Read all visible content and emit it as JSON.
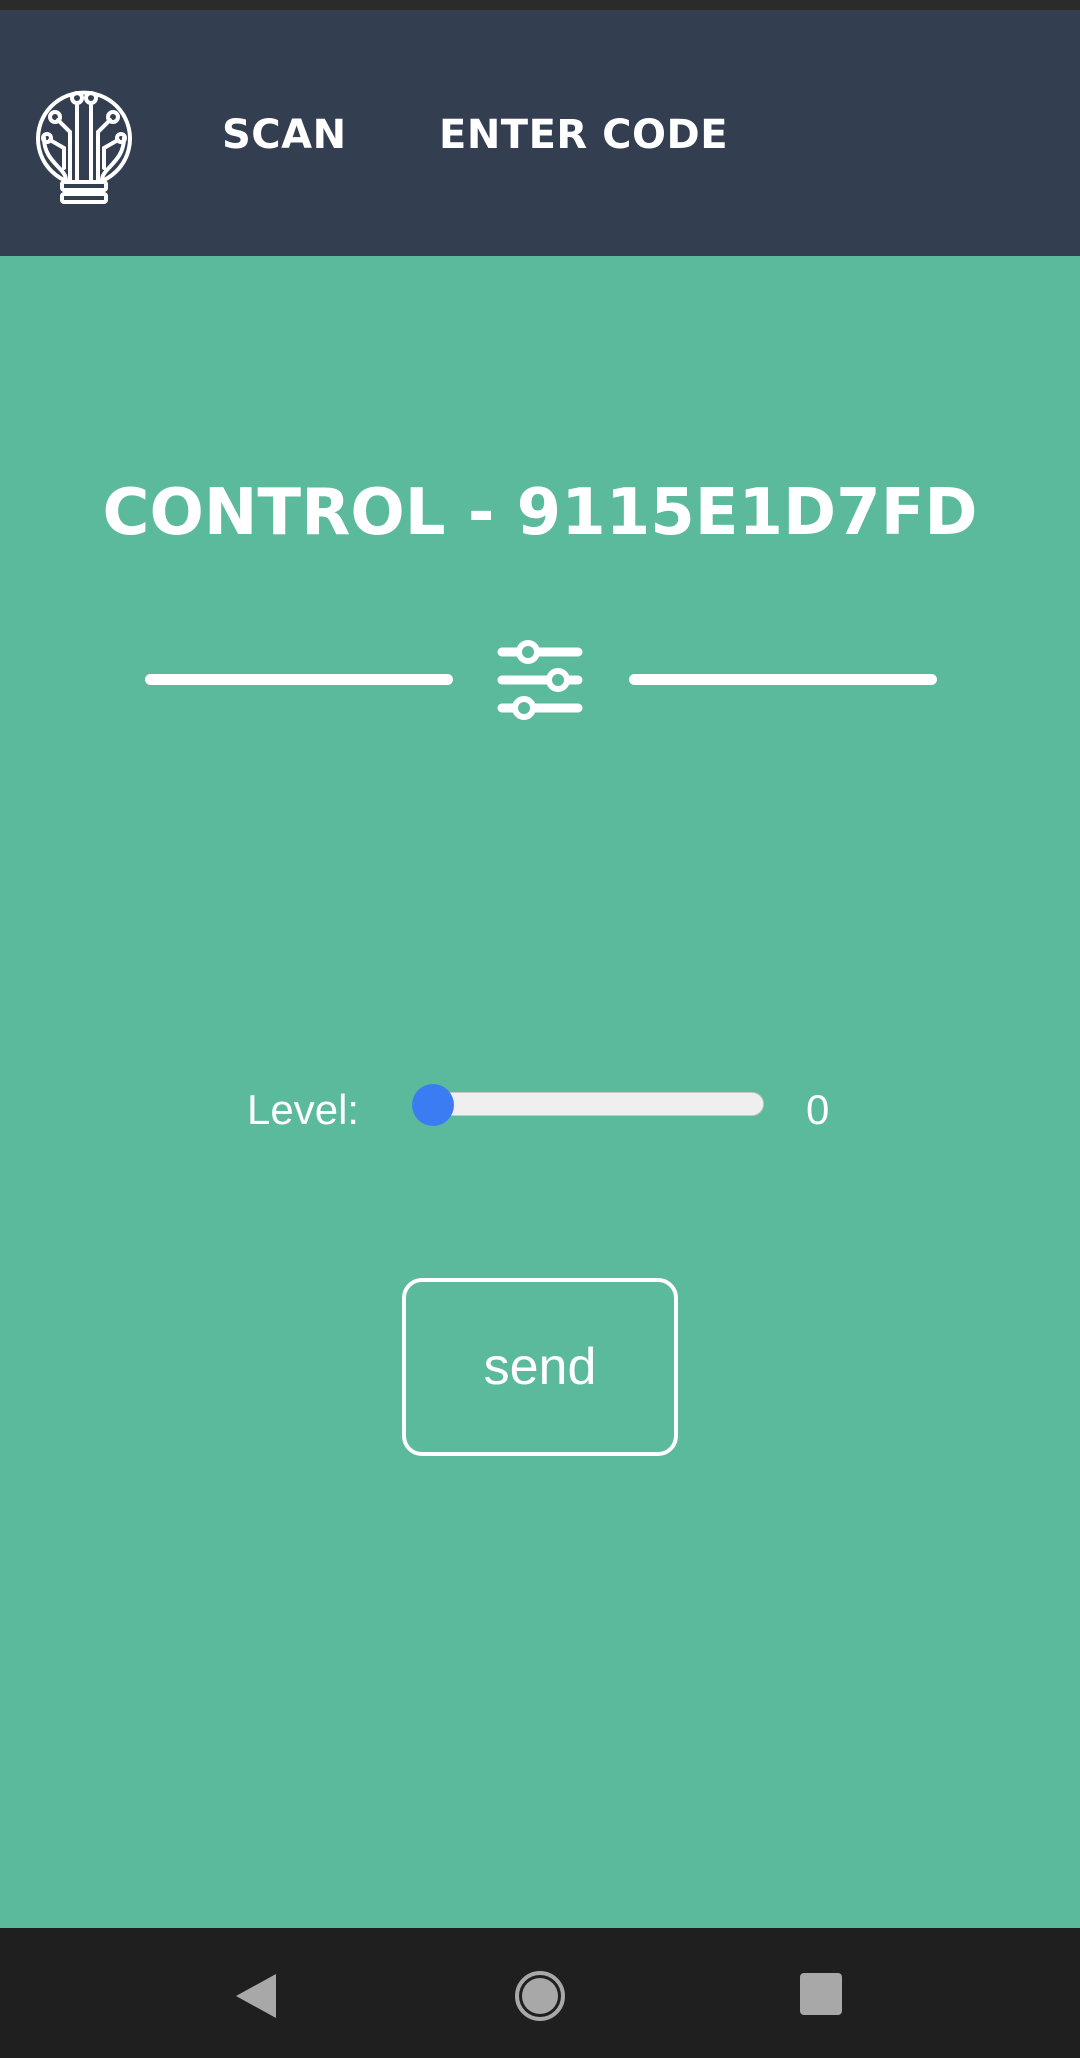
{
  "header": {
    "logo_icon": "lightbulb-circuit-icon",
    "nav": [
      {
        "label": "SCAN"
      },
      {
        "label": "ENTER CODE"
      }
    ],
    "background": "#333f50"
  },
  "main": {
    "title": "CONTROL - 9115E1D7FD",
    "divider_icon": "sliders-icon",
    "level": {
      "label": "Level:",
      "value": "0",
      "min": 0,
      "max": 100,
      "thumb_color": "#3b7cf2"
    },
    "send_label": "send",
    "background": "#5bb99c"
  },
  "system_nav": {
    "back_icon": "back-triangle-icon",
    "home_icon": "home-circle-icon",
    "recent_icon": "recent-square-icon"
  }
}
